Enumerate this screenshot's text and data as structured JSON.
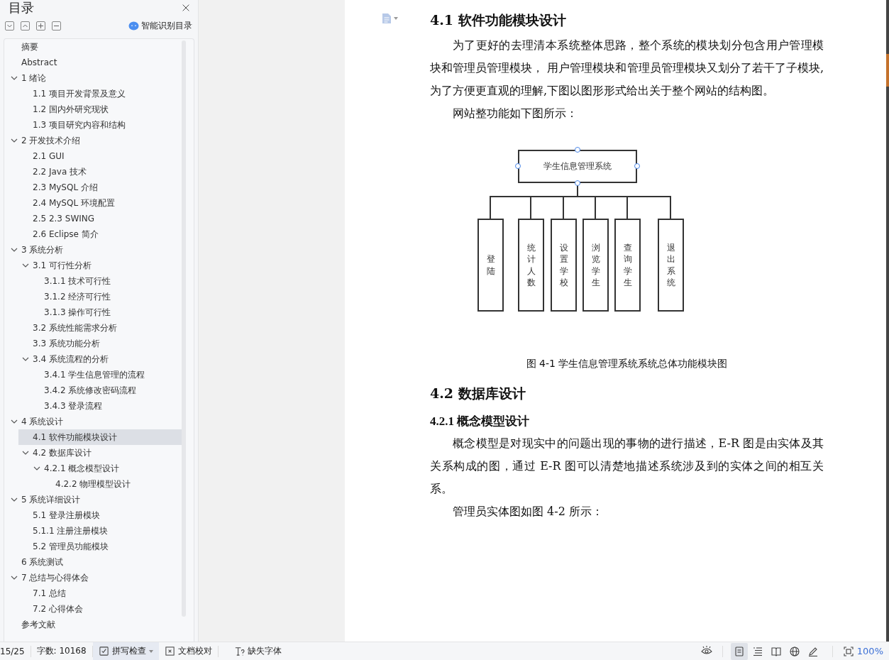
{
  "sidebar": {
    "title": "目录",
    "smart_button": {
      "label": "智能识别目录"
    },
    "outline": [
      {
        "label": "摘要",
        "selected": false
      },
      {
        "label": "Abstract",
        "selected": false
      },
      {
        "label": "1 绪论",
        "selected": false,
        "expanded": true,
        "children": [
          {
            "label": "1.1 项目开发背景及意义",
            "selected": false
          },
          {
            "label": "1.2 国内外研究现状",
            "selected": false
          },
          {
            "label": "1.3 项目研究内容和结构",
            "selected": false
          }
        ]
      },
      {
        "label": "2 开发技术介绍",
        "selected": false,
        "expanded": true,
        "children": [
          {
            "label": "2.1 GUI",
            "selected": false
          },
          {
            "label": "2.2 Java 技术",
            "selected": false
          },
          {
            "label": "2.3 MySQL  介绍",
            "selected": false
          },
          {
            "label": "2.4 MySQL 环境配置",
            "selected": false
          },
          {
            "label": "2.5 2.3 SWING",
            "selected": false
          },
          {
            "label": "2.6 Eclipse 简介",
            "selected": false
          }
        ]
      },
      {
        "label": "3 系统分析",
        "selected": false,
        "expanded": true,
        "children": [
          {
            "label": "3.1 可行性分析",
            "selected": false,
            "expanded": true,
            "children": [
              {
                "label": "3.1.1 技术可行性",
                "selected": false
              },
              {
                "label": "3.1.2 经济可行性",
                "selected": false
              },
              {
                "label": "3.1.3 操作可行性",
                "selected": false
              }
            ]
          },
          {
            "label": "3.2 系统性能需求分析",
            "selected": false
          },
          {
            "label": "3.3 系统功能分析",
            "selected": false
          },
          {
            "label": "3.4 系统流程的分析",
            "selected": false,
            "expanded": true,
            "children": [
              {
                "label": "3.4.1  学生信息管理的流程",
                "selected": false
              },
              {
                "label": "3.4.2 系统修改密码流程",
                "selected": false
              },
              {
                "label": "3.4.3  登录流程",
                "selected": false
              }
            ]
          }
        ]
      },
      {
        "label": "4 系统设计",
        "selected": false,
        "expanded": true,
        "children": [
          {
            "label": "4.1  软件功能模块设计",
            "selected": true
          },
          {
            "label": "4.2 数据库设计",
            "selected": false,
            "expanded": true,
            "children": [
              {
                "label": "4.2.1 概念模型设计",
                "selected": false,
                "expanded": true,
                "children": [
                  {
                    "label": "4.2.2 物理模型设计",
                    "selected": false
                  }
                ]
              }
            ]
          }
        ]
      },
      {
        "label": "5 系统详细设计",
        "selected": false,
        "expanded": true,
        "children": [
          {
            "label": "5.1 登录注册模块",
            "selected": false
          },
          {
            "label": "5.1.1 注册注册模块",
            "selected": false
          },
          {
            "label": "5.2 管理员功能模块",
            "selected": false
          }
        ]
      },
      {
        "label": "6 系统测试",
        "selected": false
      },
      {
        "label": "7 总结与心得体会",
        "selected": false,
        "expanded": true,
        "children": [
          {
            "label": "7.1  总结",
            "selected": false
          },
          {
            "label": "7.2  心得体会",
            "selected": false
          }
        ]
      },
      {
        "label": "参考文献",
        "selected": false
      }
    ]
  },
  "document": {
    "content": [
      {
        "kind": "h2",
        "text": "4.1  软件功能模块设计"
      },
      {
        "kind": "p",
        "text": "为了更好的去理清本系统整体思路，整个系统的模块划分包含用户管理模块和管理员管理模块， 用户管理模块和管理员管理模块又划分了若干了子模块,为了方便更直观的理解,下图以图形形式给出关于整个网站的结构图。"
      },
      {
        "kind": "p",
        "text": "网站整功能如下图所示："
      },
      {
        "kind": "diagram",
        "root": "学生信息管理系统",
        "modules": [
          "登陆",
          "统计人数",
          "设置学校",
          "浏览学生",
          "查询学生",
          "退出系统"
        ]
      },
      {
        "kind": "caption",
        "text": "图 4-1 学生信息管理系统系统总体功能模块图"
      },
      {
        "kind": "h2",
        "text": "4.2 数据库设计"
      },
      {
        "kind": "h3",
        "text": "4.2.1 概念模型设计"
      },
      {
        "kind": "p",
        "text": "概念模型是对现实中的问题出现的事物的进行描述，E-R 图是由实体及其关系构成的图，通过 E-R 图可以清楚地描述系统涉及到的实体之间的相互关系。"
      },
      {
        "kind": "p",
        "text": "管理员实体图如图 4-2 所示："
      }
    ]
  },
  "status_bar": {
    "page": "15/25",
    "word_count": "字数: 10168",
    "spell_check": "拼写检查",
    "proofread": "文档校对",
    "missing_fonts": "缺失字体",
    "view_modes": [
      {
        "kind": "page",
        "selected": true
      },
      {
        "kind": "outline",
        "selected": false
      },
      {
        "kind": "read",
        "selected": false
      },
      {
        "kind": "web",
        "selected": false
      },
      {
        "kind": "write",
        "selected": false
      }
    ],
    "zoom": "100%"
  }
}
